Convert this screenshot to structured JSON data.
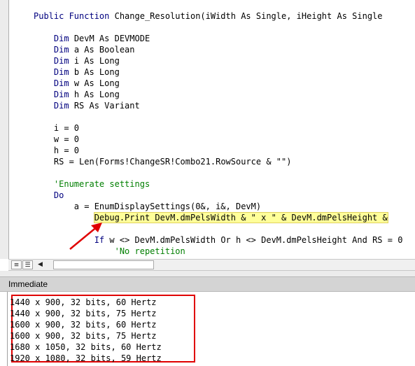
{
  "code": {
    "lines": [
      {
        "indent": "",
        "kw": "Public Function ",
        "text": "Change_Resolution(iWidth As Single, iHeight As Single"
      },
      {
        "indent": "",
        "kw": "",
        "text": ""
      },
      {
        "indent": "    ",
        "kw": "Dim ",
        "text": "DevM As DEVMODE"
      },
      {
        "indent": "    ",
        "kw": "Dim ",
        "text": "a As Boolean"
      },
      {
        "indent": "    ",
        "kw": "Dim ",
        "text": "i As Long"
      },
      {
        "indent": "    ",
        "kw": "Dim ",
        "text": "b As Long"
      },
      {
        "indent": "    ",
        "kw": "Dim ",
        "text": "w As Long"
      },
      {
        "indent": "    ",
        "kw": "Dim ",
        "text": "h As Long"
      },
      {
        "indent": "    ",
        "kw": "Dim ",
        "text": "RS As Variant"
      },
      {
        "indent": "",
        "kw": "",
        "text": ""
      },
      {
        "indent": "    ",
        "kw": "",
        "text": "i = 0"
      },
      {
        "indent": "    ",
        "kw": "",
        "text": "w = 0"
      },
      {
        "indent": "    ",
        "kw": "",
        "text": "h = 0"
      },
      {
        "indent": "    ",
        "kw": "",
        "text": "RS = Len(Forms!ChangeSR!Combo21.RowSource & \"\")"
      },
      {
        "indent": "",
        "kw": "",
        "text": ""
      },
      {
        "indent": "    ",
        "kw": "",
        "text": "'Enumerate settings",
        "comment": true
      },
      {
        "indent": "    ",
        "kw": "Do",
        "text": ""
      },
      {
        "indent": "        ",
        "kw": "",
        "text": "a = EnumDisplaySettings(0&, i&, DevM)"
      },
      {
        "indent": "            ",
        "kw": "",
        "text": "Debug.Print DevM.dmPelsWidth & \" x \" & DevM.dmPelsHeight &",
        "highlight": true
      },
      {
        "indent": "",
        "kw": "",
        "text": ""
      },
      {
        "indent": "            ",
        "kw": "If ",
        "text": "w <> DevM.dmPelsWidth Or h <> DevM.dmPelsHeight And RS = 0"
      },
      {
        "indent": "                ",
        "kw": "",
        "text": "'No repetition",
        "comment": true
      }
    ]
  },
  "immediate": {
    "title": "Immediate",
    "output": [
      "1440 x 900, 32 bits, 60 Hertz",
      "1440 x 900, 32 bits, 75 Hertz",
      "1600 x 900, 32 bits, 60 Hertz",
      "1600 x 900, 32 bits, 75 Hertz",
      "1680 x 1050, 32 bits, 60 Hertz",
      "1920 x 1080, 32 bits, 59 Hertz"
    ]
  },
  "scrollbar": {
    "procedure_view_icon": "procedure-view-icon",
    "module_view_icon": "full-module-view-icon",
    "left_arrow_icon": "scroll-left-icon"
  },
  "colors": {
    "keyword": "#00007f",
    "comment": "#007f00",
    "annotation": "#e00000"
  }
}
